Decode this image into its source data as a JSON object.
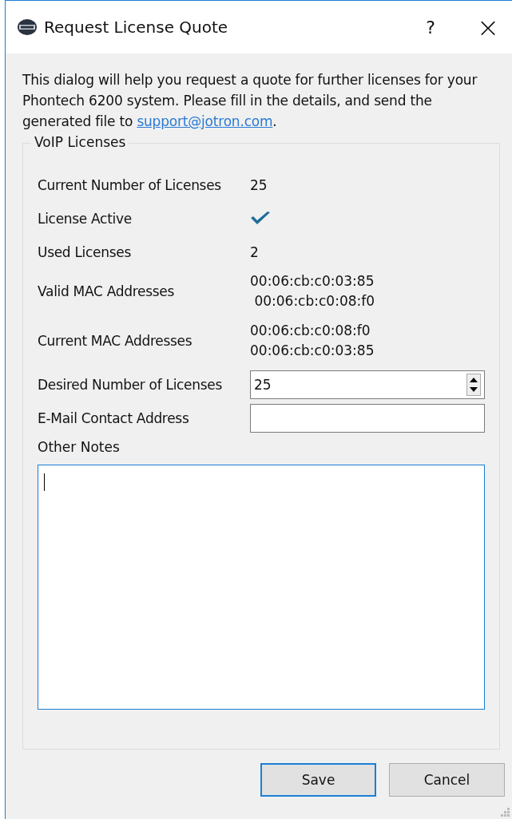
{
  "window": {
    "title": "Request License Quote",
    "help": "?",
    "close": "×"
  },
  "intro": {
    "text": "This dialog will help you request a quote for further licenses for your Phontech 6200 system. Please fill in the details, and send the generated file to",
    "link": "support@jotron.com",
    "after": "."
  },
  "group": {
    "title": "VoIP Licenses",
    "rows": [
      {
        "kind": "text",
        "label": "Current Number of Licenses",
        "value": "25"
      },
      {
        "kind": "check",
        "label": "License Active",
        "checked": true
      },
      {
        "kind": "text",
        "label": "Used Licenses",
        "value": "2"
      },
      {
        "kind": "lines",
        "label": "Valid MAC Addresses",
        "lines": [
          "00:06:cb:c0:03:85",
          " 00:06:cb:c0:08:f0"
        ]
      },
      {
        "kind": "lines",
        "label": "Current MAC Addresses",
        "lines": [
          "00:06:cb:c0:08:f0",
          "00:06:cb:c0:03:85"
        ]
      },
      {
        "kind": "spin",
        "label": "Desired Number of Licenses",
        "value": "25"
      },
      {
        "kind": "input",
        "label": "E-Mail Contact Address",
        "value": ""
      }
    ],
    "notes": {
      "label": "Other Notes",
      "focused": true
    }
  },
  "buttons": [
    {
      "label": "Save",
      "default": true
    },
    {
      "label": "Cancel",
      "default": false
    }
  ]
}
